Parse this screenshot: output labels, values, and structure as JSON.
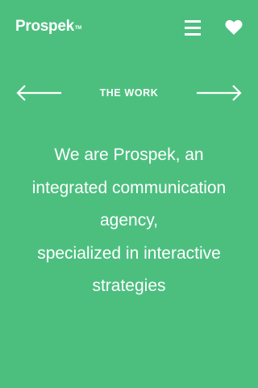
{
  "header": {
    "logo": "Prospek",
    "logo_mark": "TM",
    "menu_icon": "hamburger-menu-icon",
    "favorite_icon": "heart-icon"
  },
  "nav": {
    "prev_icon": "arrow-left-icon",
    "section_title": "THE WORK",
    "next_icon": "arrow-right-icon"
  },
  "intro": {
    "lines": [
      "We are Prospek, an",
      "integrated communication",
      "agency,",
      "specialized in interactive",
      "strategies"
    ]
  },
  "colors": {
    "background": "#4cbf7f",
    "foreground": "#ffffff"
  }
}
